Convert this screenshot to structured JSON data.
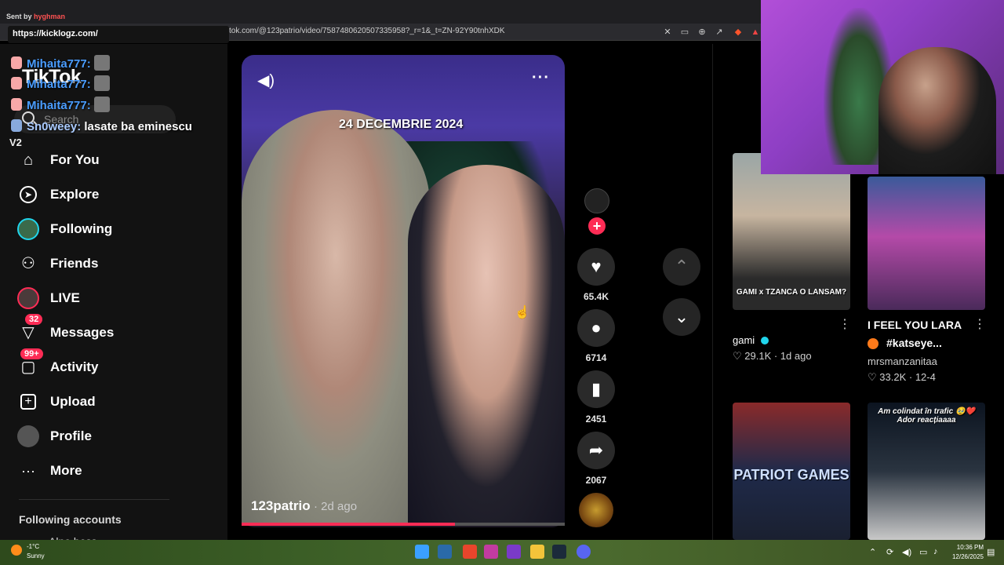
{
  "browser": {
    "url": "tok.com/@123patrio/video/7587480620507335958?_r=1&_t=ZN-92Y90tnhXDK",
    "link_popup": "https://kicklogz.com/",
    "sent_by_prefix": "Sent by",
    "sent_by_user": "hyghman"
  },
  "chat": {
    "messages": [
      {
        "user": "Mihaita777:",
        "text": ""
      },
      {
        "user": "Mihaita777:",
        "text": ""
      },
      {
        "user": "Mihaita777:",
        "text": ""
      },
      {
        "user": "Sn0weey:",
        "text": "lasate ba eminescu"
      }
    ],
    "v2": "V2"
  },
  "sidebar": {
    "logo": "TikTok",
    "search_placeholder": "Search",
    "items": [
      {
        "label": "For You",
        "icon": "home-icon"
      },
      {
        "label": "Explore",
        "icon": "compass-icon"
      },
      {
        "label": "Following",
        "icon": "following-avatar"
      },
      {
        "label": "Friends",
        "icon": "friends-icon"
      },
      {
        "label": "LIVE",
        "icon": "live-avatar"
      },
      {
        "label": "Messages",
        "icon": "messages-icon",
        "badge": "32"
      },
      {
        "label": "Activity",
        "icon": "activity-icon",
        "badge": "99+"
      },
      {
        "label": "Upload",
        "icon": "upload-icon"
      },
      {
        "label": "Profile",
        "icon": "profile-avatar"
      },
      {
        "label": "More",
        "icon": "more-icon"
      }
    ],
    "following_accounts_title": "Following accounts",
    "following_first": "Alpo boss"
  },
  "video": {
    "overlay_text": "24 DECEMBRIE 2024",
    "author": "123patrio",
    "time": "· 2d ago",
    "progress": 0.66
  },
  "actions": {
    "likes": "65.4K",
    "comments": "6714",
    "saves": "2451",
    "shares": "2067"
  },
  "grid": [
    {
      "caption": "GAMI x TZANCA O LANSAM?",
      "title": "",
      "author": "gami",
      "verified": true,
      "likes": "29.1K",
      "date": "1d ago"
    },
    {
      "caption": "",
      "title": "I FEEL YOU LARA",
      "title2": "#katseye...",
      "author": "mrsmanzanitaa",
      "likes": "33.2K",
      "date": "12-4"
    },
    {
      "caption": "PATRIOT GAMES",
      "title": "",
      "author": "",
      "likes": "",
      "date": ""
    },
    {
      "caption": "Am colindat în trafic 🥹❤️Ador reacțiaaaa",
      "title": "",
      "author": "",
      "likes": "",
      "date": ""
    }
  ],
  "taskbar": {
    "temperature": "-1°C",
    "weather": "Sunny",
    "time": "10:36 PM",
    "date": "12/26/2025"
  },
  "colors": {
    "accent": "#fe2c55",
    "verified": "#20d5ec"
  }
}
